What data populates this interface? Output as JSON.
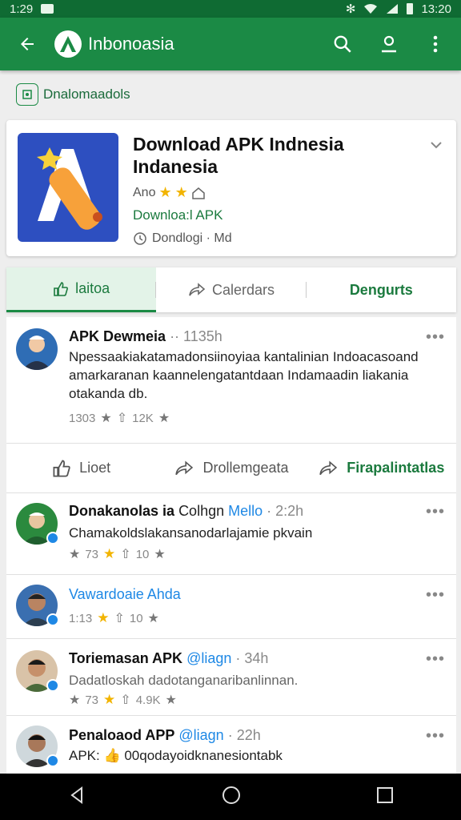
{
  "status_bar": {
    "time_left": "1:29",
    "time_right": "13:20"
  },
  "app_bar": {
    "title": "Inbonoasia"
  },
  "brand": {
    "label": "Dnalomaadols"
  },
  "app_card": {
    "title": "Download APK Indnesia Indanesia",
    "rating_prefix": "Ano",
    "download_label": "Downloa:l APK",
    "version_text": "Dondlogi · Md"
  },
  "tabs": [
    {
      "label": "laitoa"
    },
    {
      "label": "Calerdars"
    },
    {
      "label": "Dengurts"
    }
  ],
  "posts": [
    {
      "name": "APK Dewmeia",
      "time": "·· 1135h",
      "text": "Npessaakiakatamadonsiinoyiaa kantalinian Indoacasoand amarkaranan kaannelengatantdaan Indamaadin liakania otakanda db.",
      "stat_a": "1303",
      "stat_b": "12K",
      "actions": [
        "Lioet",
        "Drollemgeata",
        "Firapalintatlas"
      ]
    },
    {
      "name": "Donakanolas ia",
      "extra": "Colhgn",
      "handle": "Mello",
      "time": "· 2:2h",
      "text": "Chamakoldslakansanodarlajamie pkvain",
      "stat_a": "73",
      "stat_b": "10"
    },
    {
      "name": "Vawardoaie Ahda",
      "stat_a": "1:13",
      "stat_b": "10"
    },
    {
      "name": "Toriemasan APK",
      "handle": "@liagn",
      "time": "· 34h",
      "text": "Dadatloskah dadotanganaribanlinnan.",
      "stat_a": "73",
      "stat_b": "4.9K"
    },
    {
      "name": "Penaloaod APP",
      "handle": "@liagn",
      "time": "· 22h",
      "text": "APK: 👍 00qodayoidknanesiontabk"
    }
  ],
  "colors": {
    "primary": "#1b8a45",
    "accent_star": "#f2b400",
    "link": "#1e88e5"
  }
}
